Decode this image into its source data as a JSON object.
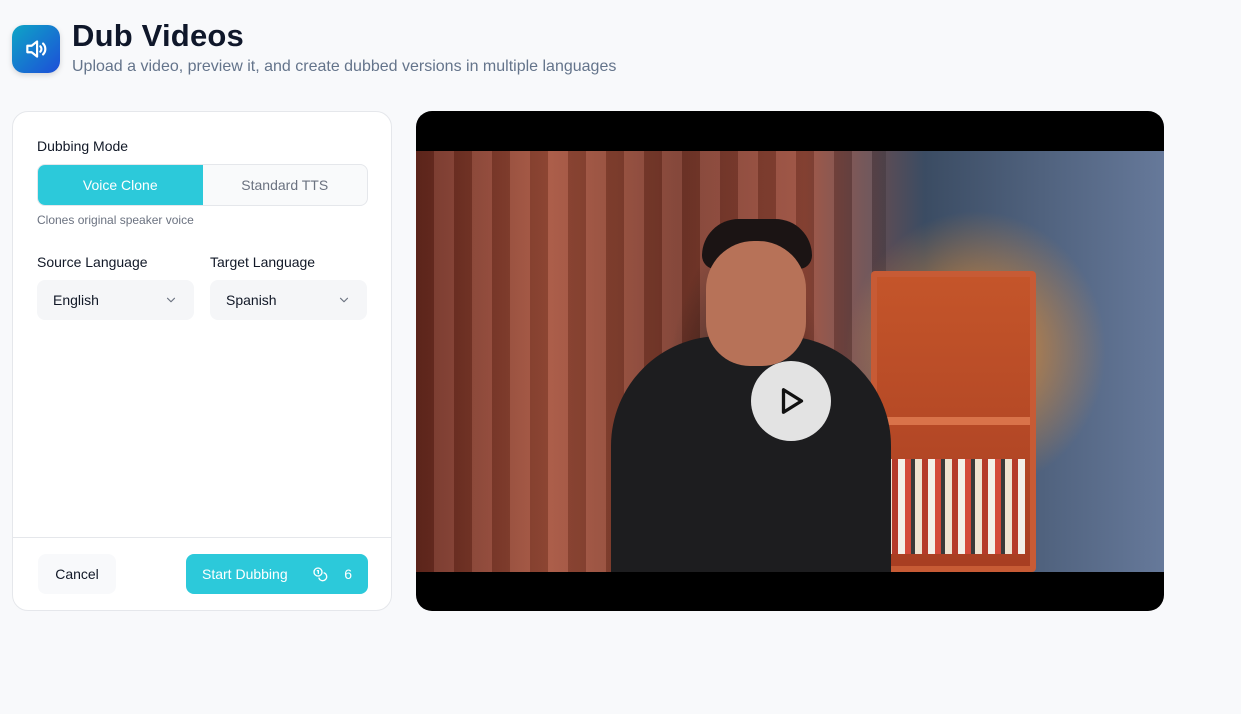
{
  "header": {
    "title": "Dub Videos",
    "subtitle": "Upload a video, preview it, and create dubbed versions in multiple languages",
    "icon": "speaker-icon"
  },
  "form": {
    "mode_label": "Dubbing Mode",
    "modes": [
      {
        "label": "Voice Clone",
        "active": true
      },
      {
        "label": "Standard TTS",
        "active": false
      }
    ],
    "mode_hint": "Clones original speaker voice",
    "source_label": "Source Language",
    "source_value": "English",
    "target_label": "Target Language",
    "target_value": "Spanish"
  },
  "actions": {
    "cancel_label": "Cancel",
    "start_label": "Start Dubbing",
    "credit_count": "6",
    "credit_icon": "coins-icon"
  },
  "video": {
    "play_icon": "play-icon"
  },
  "colors": {
    "accent": "#2cc9da",
    "icon_gradient_start": "#0ea5c6",
    "icon_gradient_end": "#1d4ed8"
  }
}
